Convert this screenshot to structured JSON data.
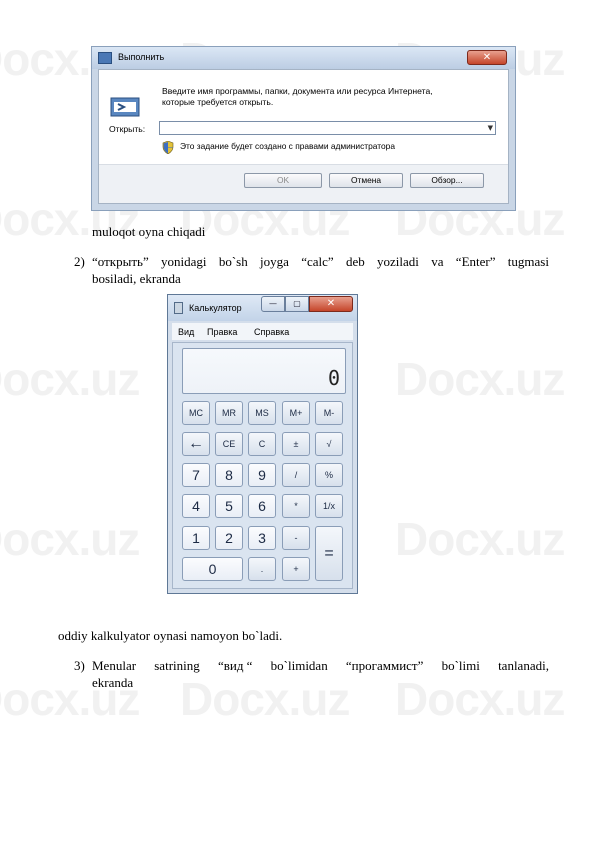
{
  "watermark": "Docx.uz",
  "run_dialog": {
    "title": "Выполнить",
    "close": "✕",
    "description": "Введите имя программы, папки, документа или ресурса Интернета, которые требуется открыть.",
    "open_label": "Открыть:",
    "input_value": "",
    "admin_note": "Это задание будет создано с правами администратора",
    "ok": "OK",
    "cancel": "Отмена",
    "browse": "Обзор..."
  },
  "text": {
    "line1": "muloqot  oyna  chiqadi",
    "item2_num": "2)",
    "item2_words": [
      "“открыть”",
      "yonidagi",
      "bo`sh",
      "joyga",
      "“calc”",
      "deb",
      "yoziladi",
      "va",
      "“Enter”",
      "tugmasi"
    ],
    "item2_cont": "bosiladi, ekranda",
    "line_calc": "oddiy  kalkulyator  oynasi  namoyon  bo`ladi.",
    "item3_num": "3)",
    "item3_words": [
      "Menular",
      "satrining",
      "“вид “",
      "bo`limidan",
      "“прогаммист”",
      "bo`limi",
      "tanlanadi,"
    ],
    "item3_cont": "ekranda"
  },
  "calculator": {
    "title": "Калькулятор",
    "window_buttons": {
      "min": "—",
      "max": "▢",
      "close": "✕"
    },
    "menu": [
      "Вид",
      "Правка",
      "Справка"
    ],
    "display": "0",
    "keys": [
      [
        "MC",
        "MR",
        "MS",
        "M+",
        "M-"
      ],
      [
        "←",
        "CE",
        "C",
        "±",
        "√"
      ],
      [
        "7",
        "8",
        "9",
        "/",
        "%"
      ],
      [
        "4",
        "5",
        "6",
        "*",
        "1/x"
      ],
      [
        "1",
        "2",
        "3",
        "-",
        "="
      ],
      [
        "0",
        ".",
        "+"
      ]
    ]
  }
}
